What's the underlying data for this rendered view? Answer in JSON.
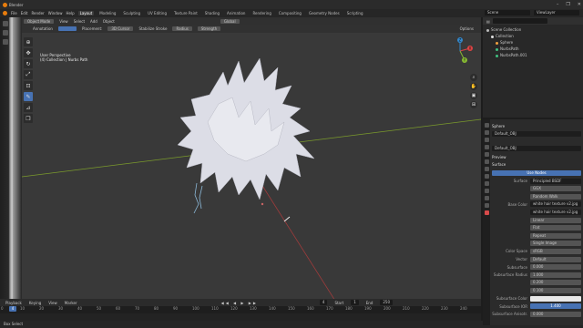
{
  "app": {
    "title": "Blender"
  },
  "window_controls": [
    "–",
    "❐",
    "✕"
  ],
  "menu": {
    "items": [
      "File",
      "Edit",
      "Render",
      "Window",
      "Help"
    ],
    "workspaces": [
      "Layout",
      "Modeling",
      "Sculpting",
      "UV Editing",
      "Texture Paint",
      "Shading",
      "Animation",
      "Rendering",
      "Compositing",
      "Geometry Nodes",
      "Scripting"
    ],
    "active_workspace": "Layout",
    "scene": "Scene",
    "view_layer": "ViewLayer"
  },
  "viewport": {
    "mode": "Object Mode",
    "header_menus": [
      "View",
      "Select",
      "Add",
      "Object"
    ],
    "orientation": "Global",
    "tool_settings": [
      "Annotation",
      "Placement:",
      "3D Cursor",
      "Stabilize Stroke",
      "Radius",
      "Strength"
    ],
    "options": "Options",
    "info_line1": "User Perspective",
    "info_line2": "(4) Collection | Nurbs Path",
    "gizmo": {
      "x": "X",
      "y": "Y",
      "z": "Z"
    },
    "tool_icons": [
      "cursor-icon",
      "move-icon",
      "rotate-icon",
      "scale-icon",
      "transform-icon",
      "annotate-icon",
      "measure-icon",
      "add-cube-icon"
    ],
    "nav_icons": [
      "zoom-icon",
      "pan-icon",
      "camera-view-icon",
      "ortho-toggle-icon"
    ]
  },
  "timeline": {
    "menus": [
      "Playback",
      "Keying",
      "View",
      "Marker"
    ],
    "current_frame": "4",
    "start_label": "Start",
    "start": "1",
    "end_label": "End",
    "end": "250",
    "ruler": [
      "0",
      "10",
      "20",
      "30",
      "40",
      "50",
      "60",
      "70",
      "80",
      "90",
      "100",
      "110",
      "120",
      "130",
      "140",
      "150",
      "160",
      "170",
      "180",
      "190",
      "200",
      "210",
      "220",
      "230",
      "240",
      "250"
    ]
  },
  "status": {
    "text": "Box Select"
  },
  "outliner": {
    "title": "Scene Collection",
    "rows": [
      {
        "label": "Scene Collection",
        "indent": 0,
        "color": "#bbbbbb"
      },
      {
        "label": "Collection",
        "indent": 1,
        "color": "#e0e0e0"
      },
      {
        "label": "Sphere",
        "indent": 2,
        "color": "#f0a040"
      },
      {
        "label": "NurbsPath",
        "indent": 2,
        "color": "#40c080"
      },
      {
        "label": "NurbsPath.001",
        "indent": 2,
        "color": "#40c080"
      }
    ]
  },
  "properties": {
    "object": "Sphere",
    "material_slot": "Default_OBJ",
    "material_name": "Default_OBJ",
    "sections": {
      "preview": "Preview",
      "surface": "Surface"
    },
    "use_nodes": "Use Nodes",
    "rows": [
      {
        "label": "Surface",
        "value": "Principled BSDF",
        "style": "dark"
      },
      {
        "label": "",
        "value": "GGX",
        "style": ""
      },
      {
        "label": "",
        "value": "Random Walk",
        "style": ""
      },
      {
        "label": "Base Color",
        "value": "white hair texture v2.jpg",
        "style": "dark"
      },
      {
        "label": "",
        "value": "white hair texture v2.jpg",
        "style": "dark"
      },
      {
        "label": "",
        "value": "Linear",
        "style": ""
      },
      {
        "label": "",
        "value": "Flat",
        "style": ""
      },
      {
        "label": "",
        "value": "Repeat",
        "style": ""
      },
      {
        "label": "",
        "value": "Single Image",
        "style": ""
      },
      {
        "label": "Color Space",
        "value": "sRGB",
        "style": ""
      },
      {
        "label": "Vector",
        "value": "Default",
        "style": ""
      },
      {
        "label": "Subsurface",
        "value": "0.000",
        "style": ""
      },
      {
        "label": "Subsurface Radius",
        "value": "1.000",
        "style": ""
      },
      {
        "label": "",
        "value": "0.200",
        "style": ""
      },
      {
        "label": "",
        "value": "0.100",
        "style": ""
      },
      {
        "label": "Subsurface Color",
        "value": "",
        "style": "white"
      },
      {
        "label": "Subsurface IOR",
        "value": "1.400",
        "style": "blue"
      },
      {
        "label": "Subsurface Anisotr.",
        "value": "0.000",
        "style": ""
      }
    ]
  },
  "colors": {
    "accent": "#4772b3",
    "viewport_bg": "#393939",
    "hair": "#dcdde6",
    "x_axis": "#9e3b3b",
    "y_axis": "#7a9a2c"
  }
}
